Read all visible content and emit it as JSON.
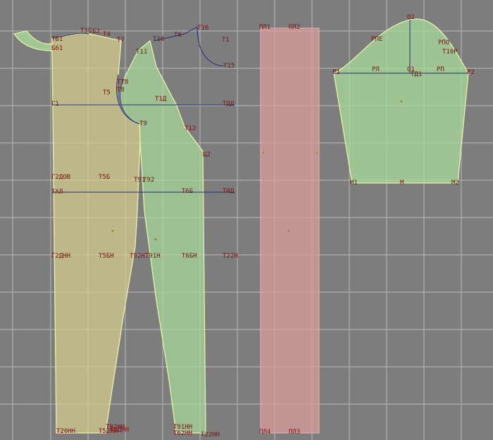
{
  "colors": {
    "background": "#7d7d7d",
    "grid": "#b9b9b9",
    "label": "#7a1212",
    "front_fill": "#d7cf8e",
    "back_fill": "#a9d99a",
    "sleeve_fill": "#a9d99a",
    "strip_fill": "#d99c9c",
    "outline": "#e8f2a8",
    "construction": "#1f2f7a"
  },
  "labels": {
    "front": [
      "ТБ1",
      "Б61",
      "ТЗБ",
      "Б2",
      "Т4",
      "Т7",
      "Т5",
      "Т8",
      "ТТ8",
      "Г1",
      "Г2ДОВ",
      "Т5Б",
      "ТАЛ",
      "Г2ДНН",
      "Т5БН",
      "Т20НН",
      "Т52НН",
      "Т2ДНН"
    ],
    "back": [
      "Т16",
      "Т6",
      "Т10",
      "Т11",
      "Т15",
      "Т1",
      "Т1Д",
      "ТДД",
      "Т9",
      "Т12",
      "Ц2",
      "Т91",
      "Т92",
      "Т6Б",
      "Т0Д",
      "Т92Н",
      "Т91Н",
      "Т6БН",
      "Т22Н",
      "Т91НН",
      "Т92НН",
      "Т62НН",
      "Т22НН"
    ],
    "strip": [
      "ПЛ1",
      "ПЛ2",
      "ПЛ4",
      "ПЛ3"
    ],
    "sleeve": [
      "О2",
      "РПЕ",
      "РПО",
      "Т10Р",
      "Р1",
      "РЛ",
      "О1",
      "ТД1",
      "РП",
      "Р2",
      "М1",
      "М",
      "М2"
    ]
  }
}
